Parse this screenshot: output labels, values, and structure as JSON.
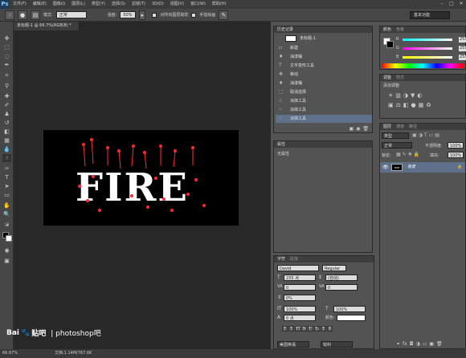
{
  "app": {
    "logo": "Ps"
  },
  "menu": [
    "文件(F)",
    "编辑(E)",
    "图像(I)",
    "图层(L)",
    "类型(Y)",
    "选择(S)",
    "滤镜(T)",
    "3D(D)",
    "视图(V)",
    "窗口(W)",
    "帮助(H)"
  ],
  "options": {
    "mode_label": "模式:",
    "mode_value": "正常",
    "opacity_label": "强度:",
    "opacity_value": "50%",
    "sample_all": "对所有图层取样",
    "finger_paint": "手指绘画",
    "workspace": "基本功能"
  },
  "doc": {
    "tab": "未标题-1 @ 66.7%(RGB/8) *",
    "canvas_text": "FIRE"
  },
  "status": {
    "zoom": "66.67%",
    "doc_size": "文档:1.14M/767.6K"
  },
  "watermark": {
    "brand": "Bai",
    "paw": "🐾",
    "tieba": "贴吧",
    "site": "| photoshop吧"
  },
  "history": {
    "title": "历史记录",
    "snapshot": "未标题-1",
    "items": [
      "新建",
      "油漆桶",
      "文字变形工具",
      "移动",
      "油漆桶",
      "取消选择",
      "涂抹工具",
      "涂抹工具",
      "涂抹工具"
    ]
  },
  "props": {
    "title": "属性",
    "content": "无属性"
  },
  "color": {
    "tabs": [
      "颜色",
      "色板"
    ],
    "r": "255",
    "g": "255",
    "b": "255"
  },
  "adjust": {
    "tabs": [
      "调整",
      "样式"
    ],
    "subtitle": "添加调整"
  },
  "layers": {
    "tabs": [
      "图层",
      "通道",
      "路径"
    ],
    "kind": "类型",
    "mode": "正常",
    "opacity_label": "不透明度:",
    "opacity_value": "100%",
    "lock_label": "锁定:",
    "fill_label": "填充:",
    "fill_value": "100%",
    "layer_name": "背景"
  },
  "char": {
    "tabs": [
      "字符",
      "段落"
    ],
    "font": "David",
    "style": "Regular",
    "size": "235 点",
    "leading": "(自动)",
    "kern": "0",
    "track": "0",
    "vscale": "0%",
    "scale_v": "100%",
    "scale_h": "100%",
    "baseline": "0 点",
    "color_label": "颜色:",
    "language": "美国英语",
    "aa": "锐利",
    "styles": [
      "T",
      "T",
      "TT",
      "Tr",
      "T¹",
      "T₁",
      "T",
      "Ŧ"
    ]
  }
}
